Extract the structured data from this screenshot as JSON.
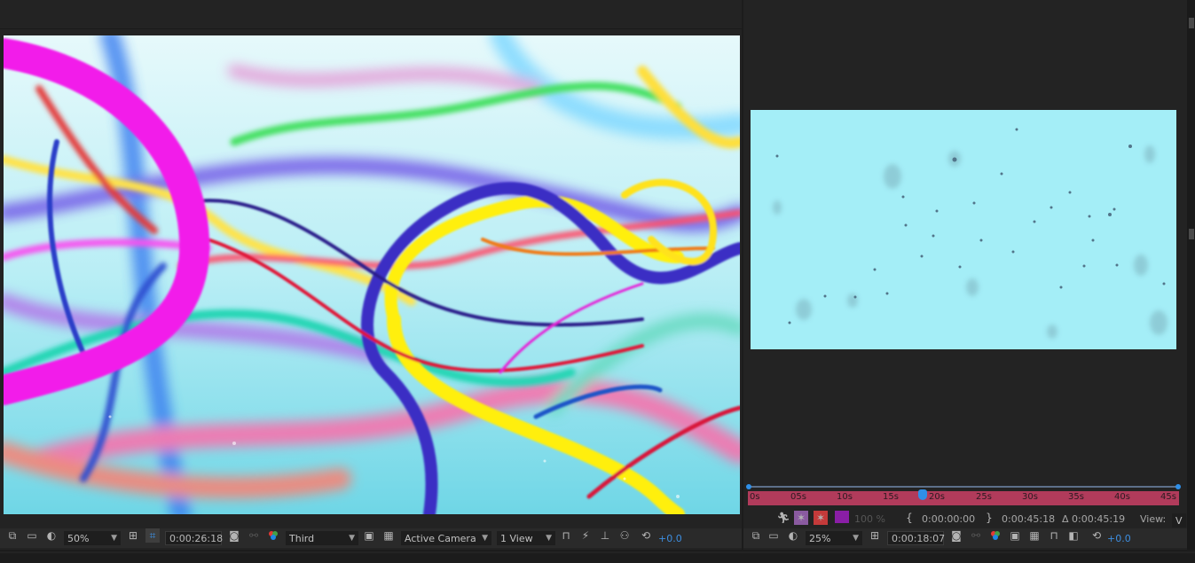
{
  "left_viewer": {
    "toolbar": {
      "zoom": "50%",
      "timecode": "0:00:26:18",
      "view_layout": "Third",
      "camera": "Active Camera",
      "views": "1 View",
      "exposure": "+0.0"
    }
  },
  "right_viewer": {
    "time_ruler": {
      "labels": [
        "0s",
        "05s",
        "10s",
        "15s",
        "20s",
        "25s",
        "30s",
        "35s",
        "40s",
        "45s"
      ],
      "playhead_label": "20s"
    },
    "render_controls": {
      "opacity": "100 %",
      "in_point": "0:00:00:00",
      "out_point": "0:00:45:18",
      "duration": "Δ 0:00:45:19",
      "view_label": "View:",
      "view_value": "V"
    },
    "toolbar": {
      "zoom": "25%",
      "timecode": "0:00:18:07",
      "exposure": "+0.0"
    }
  },
  "colors": {
    "ruler": "#b13b5b",
    "playhead": "#2f8fe8",
    "preview_bg": "#a4eef7",
    "accent_value": "#3d8ee0"
  }
}
